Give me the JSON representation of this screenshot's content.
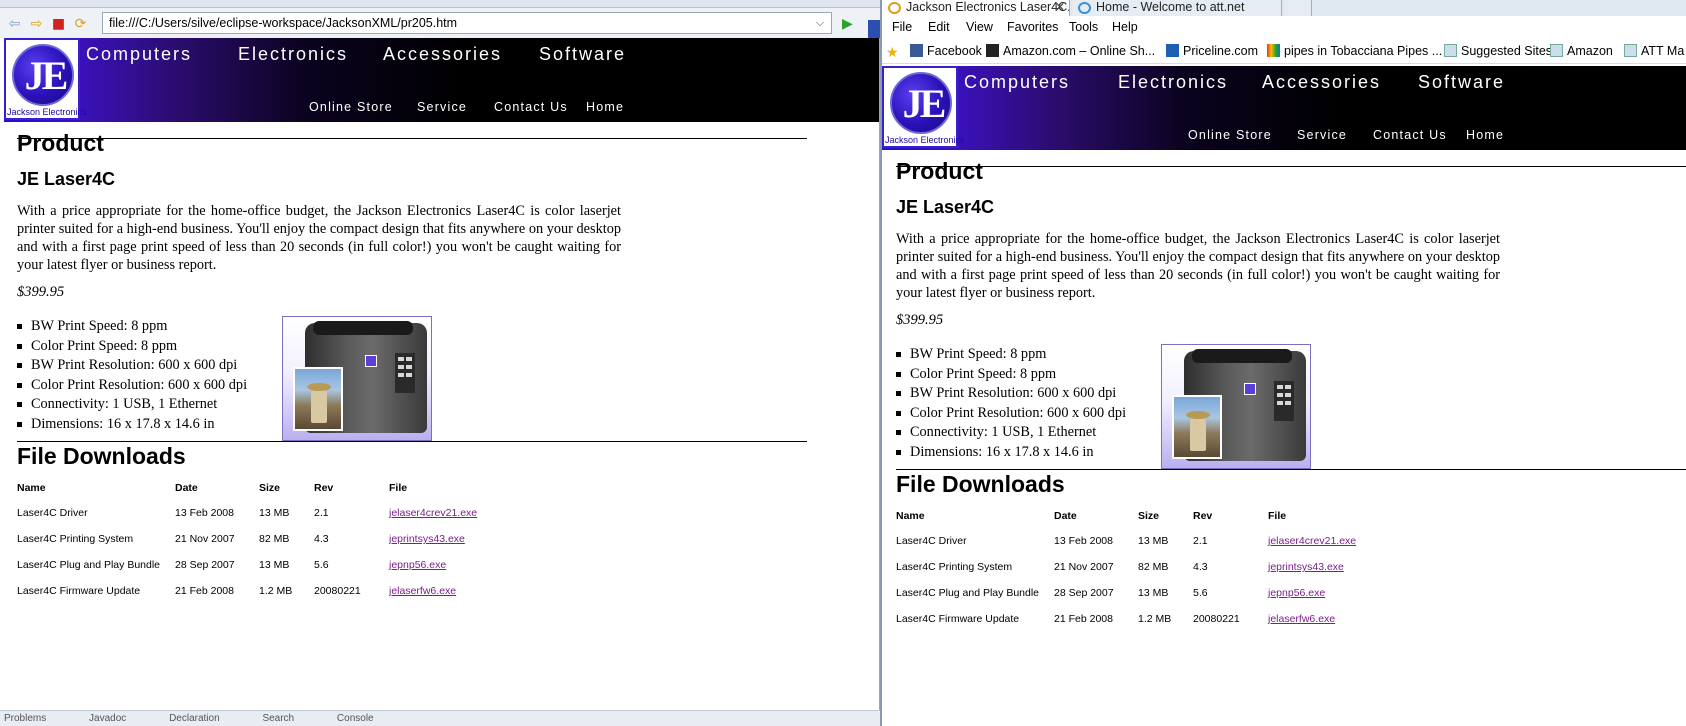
{
  "left_browser": {
    "url": "file:///C:/Users/silve/eclipse-workspace/JacksonXML/pr205.htm",
    "status_items": [
      "Problems",
      "Javadoc",
      "Declaration",
      "Search",
      "Console"
    ]
  },
  "right_browser": {
    "tabs": [
      {
        "title": "Jackson Electronics Laser4C..."
      },
      {
        "title": "Home - Welcome to att.net"
      }
    ],
    "menu": [
      "File",
      "Edit",
      "View",
      "Favorites",
      "Tools",
      "Help"
    ],
    "favorites": [
      "Facebook",
      "Amazon.com – Online Sh...",
      "Priceline.com",
      "pipes in Tobacciana Pipes ...",
      "Suggested Sites",
      "Amazon",
      "ATT Ma"
    ]
  },
  "site": {
    "logo_text": "JE",
    "logo_caption": "Jackson Electronics",
    "top_nav": [
      "Computers",
      "Electronics",
      "Accessories",
      "Software"
    ],
    "sub_nav": [
      "Online Store",
      "Service",
      "Contact Us",
      "Home"
    ]
  },
  "product": {
    "section_title": "Product",
    "name": "JE Laser4C",
    "description": "With a price appropriate for the home-office budget, the Jackson Electronics Laser4C is color laserjet printer suited for a high-end business. You'll enjoy the compact design that fits anywhere on your desktop and with a first page print speed of less than 20 seconds (in full color!) you won't be caught waiting for your latest flyer or business report.",
    "price": "$399.95",
    "specs": [
      "BW Print Speed: 8 ppm",
      "Color Print Speed: 8 ppm",
      "BW Print Resolution: 600 x 600 dpi",
      "Color Print Resolution: 600 x 600 dpi",
      "Connectivity: 1 USB, 1 Ethernet",
      "Dimensions: 16 x 17.8 x 14.6 in"
    ]
  },
  "downloads": {
    "section_title": "File Downloads",
    "headers": [
      "Name",
      "Date",
      "Size",
      "Rev",
      "File"
    ],
    "rows": [
      {
        "name": "Laser4C Driver",
        "date": "13 Feb 2008",
        "size": "13 MB",
        "rev": "2.1",
        "file": "jelaser4crev21.exe"
      },
      {
        "name": "Laser4C Printing System",
        "date": "21 Nov 2007",
        "size": "82 MB",
        "rev": "4.3",
        "file": "jeprintsys43.exe"
      },
      {
        "name": "Laser4C Plug and Play Bundle",
        "date": "28 Sep 2007",
        "size": "13 MB",
        "rev": "5.6",
        "file": "jepnp56.exe"
      },
      {
        "name": "Laser4C Firmware Update",
        "date": "21 Feb 2008",
        "size": "1.2 MB",
        "rev": "20080221",
        "file": "jelaserfw6.exe"
      }
    ]
  },
  "colors": {
    "header_gradient_start": "#1f10d8",
    "header_gradient_end": "#000000",
    "link_visited": "#7a1f8a"
  }
}
